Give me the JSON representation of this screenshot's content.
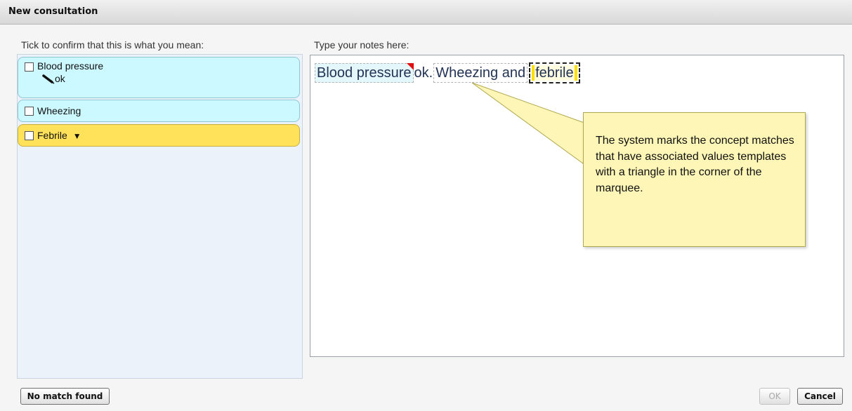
{
  "window": {
    "title": "New consultation"
  },
  "left": {
    "label": "Tick to confirm that this is what you mean:",
    "concepts": [
      {
        "label": "Blood pressure",
        "value": "ok"
      },
      {
        "label": "Wheezing"
      },
      {
        "label": "Febrile",
        "dropdown_icon": "▼"
      }
    ]
  },
  "notes": {
    "label": "Type your notes here:",
    "segments": [
      "Blood pressure",
      "ok.",
      "Wheezing and",
      "febrile"
    ]
  },
  "callout": {
    "text": "The system marks the concept matches that have associated values templates with a triangle in the corner of the marquee."
  },
  "buttons": {
    "no_match": "No match found",
    "ok": "OK",
    "cancel": "Cancel"
  },
  "icons": [
    "pencil-icon",
    "dropdown-arrow-icon",
    "value-template-triangle-icon"
  ],
  "colors": {
    "concept_bg": "#ccf9ff",
    "active_concept_bg": "#ffe25a",
    "callout_bg": "#fdf6b6",
    "triangle": "#e01010"
  }
}
